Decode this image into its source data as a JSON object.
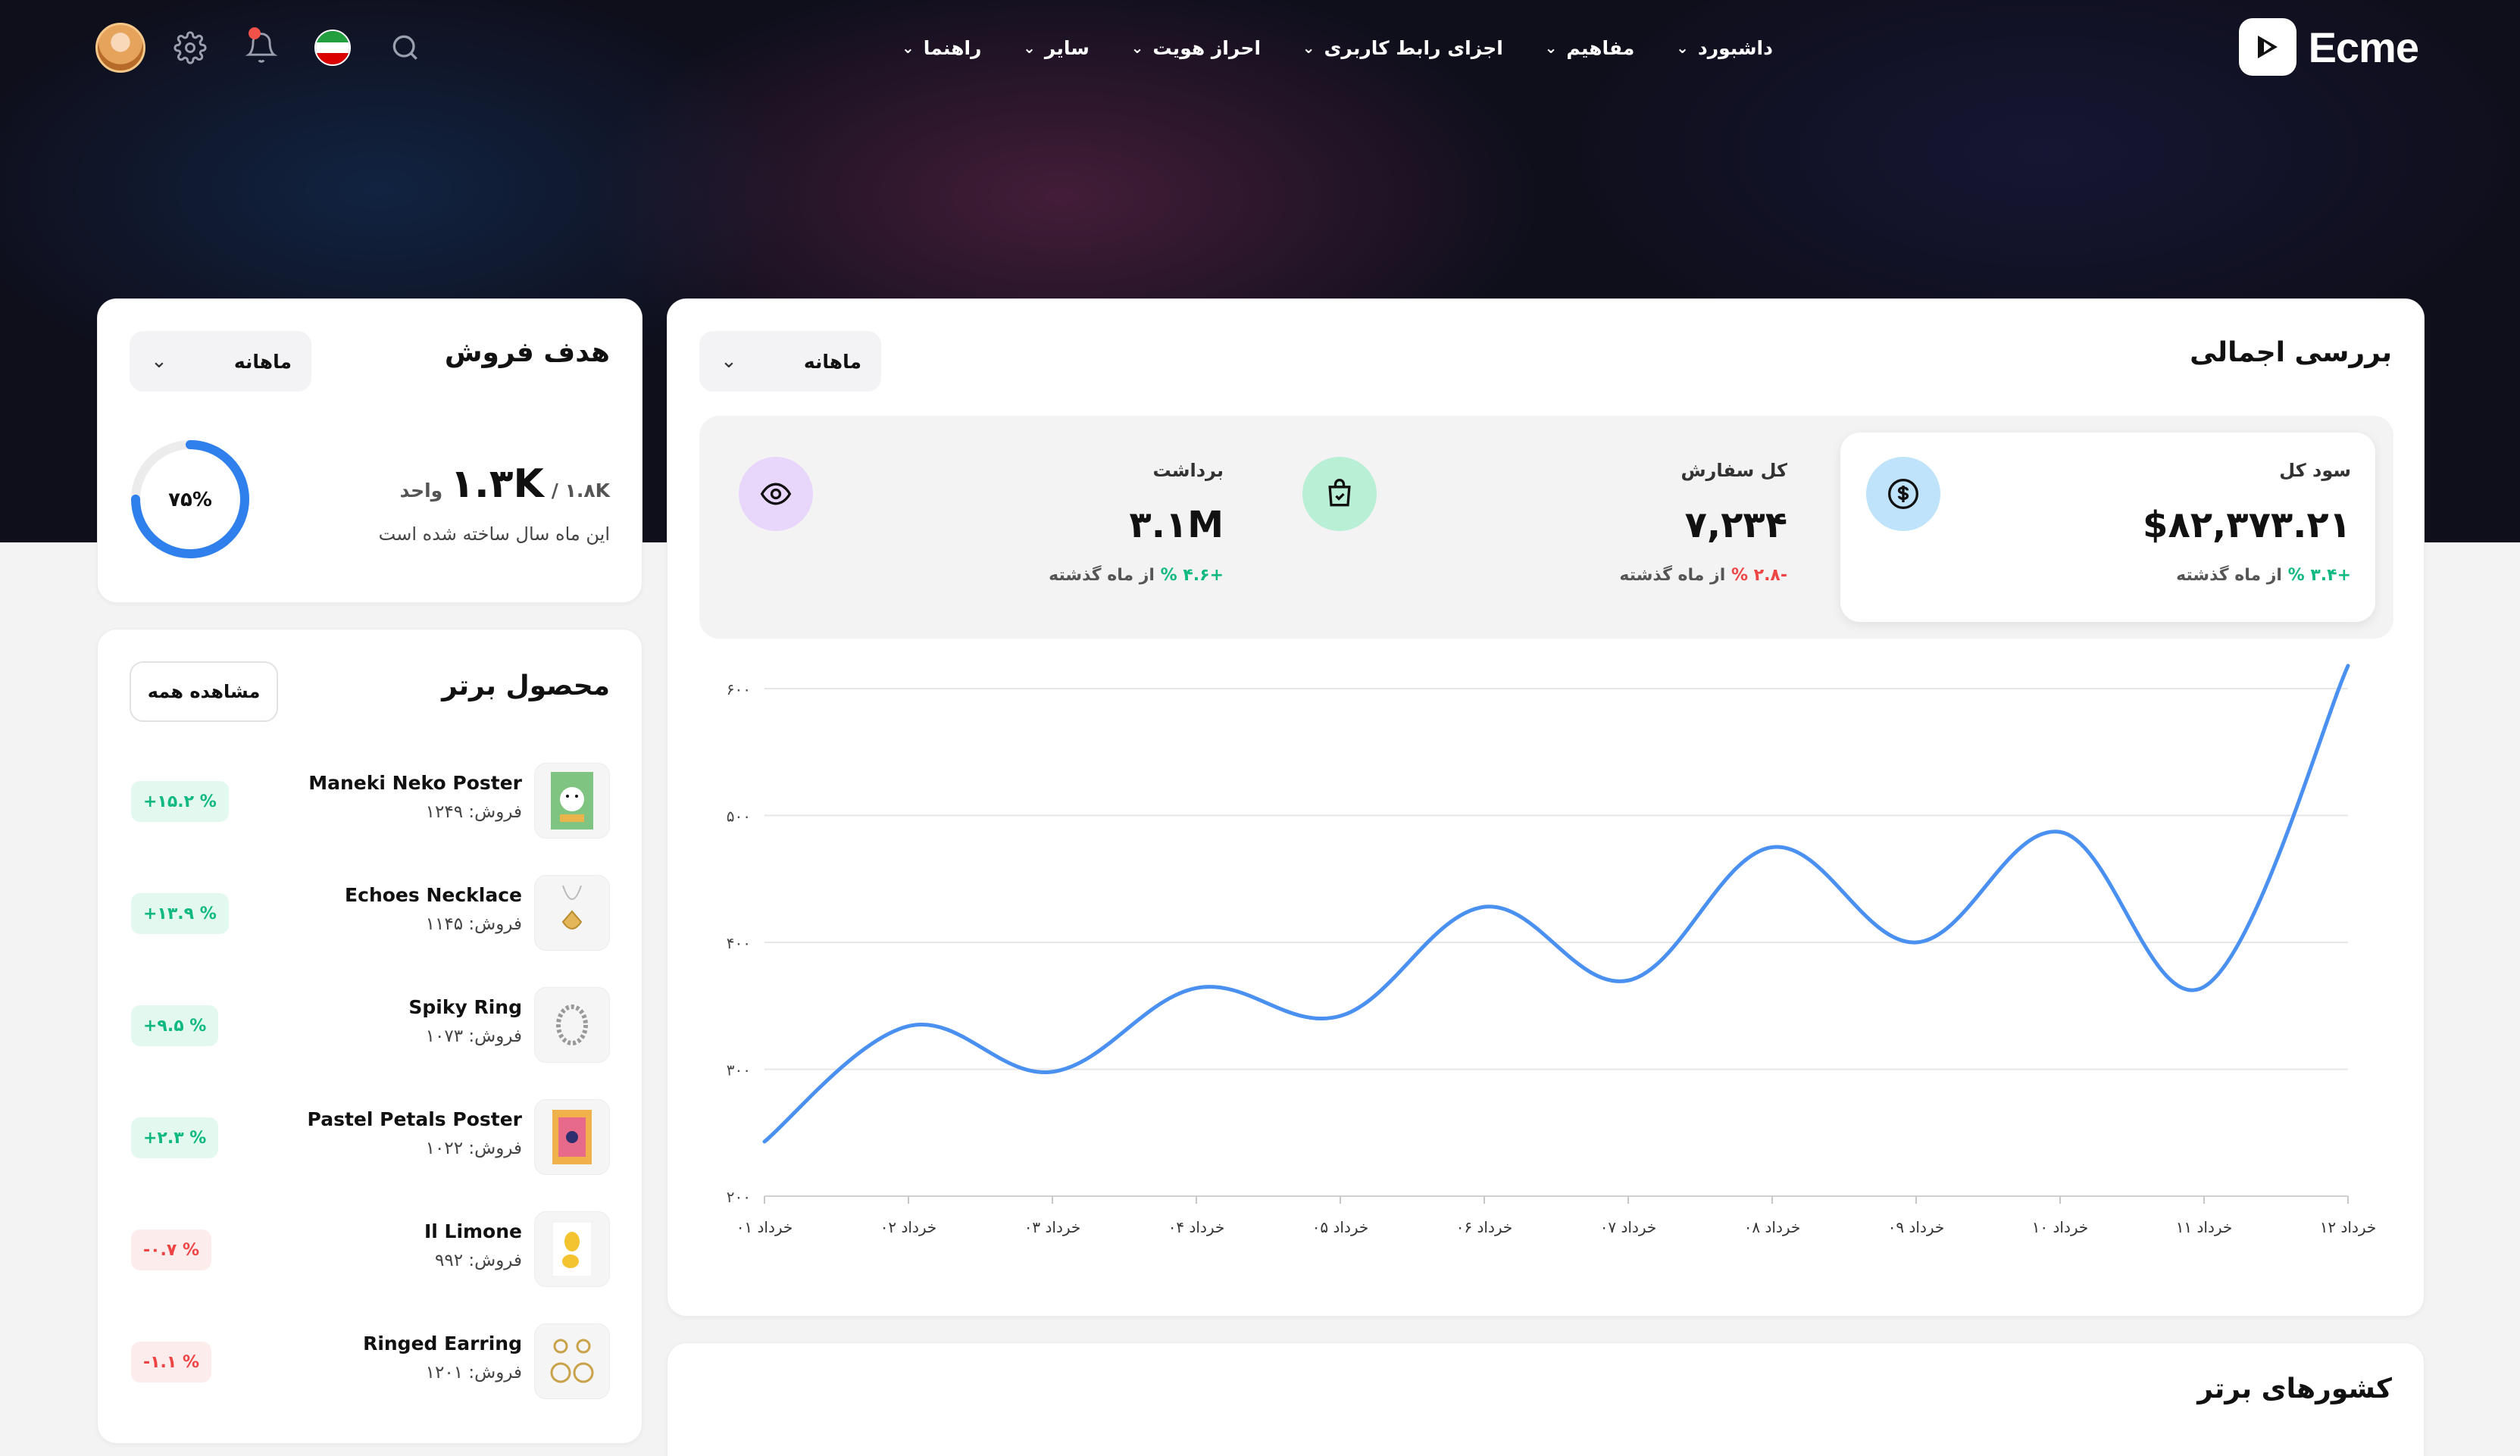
{
  "brand": {
    "name": "Ecme"
  },
  "nav": {
    "items": [
      "داشبورد",
      "مفاهیم",
      "اجزای رابط کاربری",
      "احراز هویت",
      "سایر",
      "راهنما"
    ]
  },
  "overview": {
    "title": "بررسی اجمالی",
    "period": "ماهانه",
    "stats": [
      {
        "label": "سود کل",
        "value": "$۸۲,۳۷۳.۲۱",
        "delta": "+۳.۴ %",
        "delta_suffix": "از ماه گذشته",
        "trend": "up",
        "icon": "dollar-icon",
        "icon_bg": "#bfe3fb"
      },
      {
        "label": "کل سفارش",
        "value": "۷,۲۳۴",
        "delta": "-۲.۸ %",
        "delta_suffix": "از ماه گذشته",
        "trend": "down",
        "icon": "shopping-bag-icon",
        "icon_bg": "#b9f0d5"
      },
      {
        "label": "برداشت",
        "value": "۳.۱M",
        "delta": "+۴.۶ %",
        "delta_suffix": "از ماه گذشته",
        "trend": "up",
        "icon": "eye-icon",
        "icon_bg": "#e8d6fb"
      }
    ]
  },
  "chart_data": {
    "type": "line",
    "title": "",
    "xlabel": "",
    "ylabel": "",
    "categories": [
      "خرداد ۰۱",
      "خرداد ۰۲",
      "خرداد ۰۳",
      "خرداد ۰۴",
      "خرداد ۰۵",
      "خرداد ۰۶",
      "خرداد ۰۷",
      "خرداد ۰۸",
      "خرداد ۰۹",
      "خرداد ۱۰",
      "خرداد ۱۱",
      "خرداد ۱۲"
    ],
    "series": [
      {
        "values": [
          243,
          334,
          298,
          364,
          342,
          428,
          370,
          475,
          400,
          487,
          365,
          618
        ]
      }
    ],
    "ylim": [
      200,
      600
    ],
    "yticks": [
      200,
      300,
      400,
      500,
      600
    ],
    "ytick_labels": [
      "۲۰۰",
      "۳۰۰",
      "۴۰۰",
      "۵۰۰",
      "۶۰۰"
    ],
    "grid": true,
    "color": "#4a90f0"
  },
  "sales_goal": {
    "title": "هدف فروش",
    "period": "ماهانه",
    "value": "۱.۳K",
    "target": "/ ۱.۸K",
    "unit": "واحد",
    "caption": "این ماه سال ساخته شده است",
    "progress_label": "۷۵%",
    "progress": 0.75
  },
  "top_products": {
    "title": "محصول برتر",
    "view_all": "مشاهده همه",
    "items": [
      {
        "name": "Maneki Neko Poster",
        "sales": "فروش: ۱۲۴۹",
        "growth": "+۱۵.۲ %",
        "trend": "up"
      },
      {
        "name": "Echoes Necklace",
        "sales": "فروش: ۱۱۴۵",
        "growth": "+۱۳.۹ %",
        "trend": "up"
      },
      {
        "name": "Spiky Ring",
        "sales": "فروش: ۱۰۷۳",
        "growth": "+۹.۵ %",
        "trend": "up"
      },
      {
        "name": "Pastel Petals Poster",
        "sales": "فروش: ۱۰۲۲",
        "growth": "+۲.۳ %",
        "trend": "up"
      },
      {
        "name": "Il Limone",
        "sales": "فروش: ۹۹۲",
        "growth": "-۰.۷ %",
        "trend": "down"
      },
      {
        "name": "Ringed Earring",
        "sales": "فروش: ۱۲۰۱",
        "growth": "-۱.۱ %",
        "trend": "down"
      }
    ]
  },
  "top_countries": {
    "title": "کشورهای برتر"
  }
}
